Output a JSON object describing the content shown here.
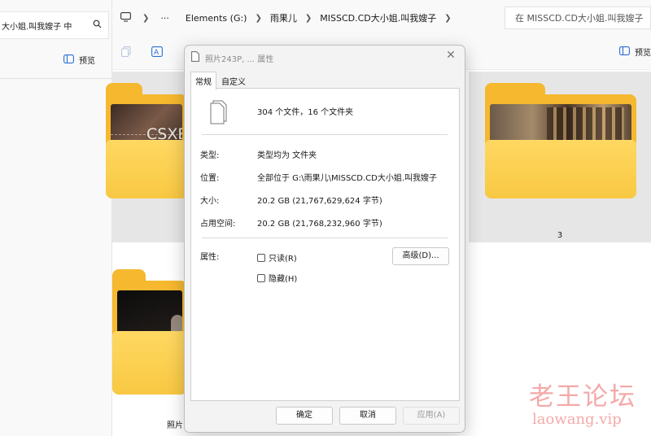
{
  "left_window": {
    "search_text": "大小姐.叫我嫂子 中",
    "preview_label": "预览"
  },
  "address_bar": {
    "crumbs": [
      "Elements (G:)",
      "雨果儿",
      "MISSCD.CD大小姐.叫我嫂子"
    ],
    "search_placeholder": "在 MISSCD.CD大小姐.叫我嫂子"
  },
  "toolbar": {
    "preview_label": "预览"
  },
  "tiles": [
    {
      "label": "",
      "photo_text": "CSXE"
    },
    {
      "label": "3"
    },
    {
      "label": "照片"
    }
  ],
  "dialog": {
    "title": "照片243P, ... 属性",
    "tabs": [
      "常规",
      "自定义"
    ],
    "summary": "304 个文件，16 个文件夹",
    "rows": [
      {
        "label": "类型:",
        "value": "类型均为 文件夹"
      },
      {
        "label": "位置:",
        "value": "全部位于 G:\\雨果儿\\MISSCD.CD大小姐.叫我嫂子"
      },
      {
        "label": "大小:",
        "value": "20.2 GB (21,767,629,624 字节)"
      },
      {
        "label": "占用空间:",
        "value": "20.2 GB (21,768,232,960 字节)"
      }
    ],
    "attributes_label": "属性:",
    "readonly_label": "只读(R)",
    "hidden_label": "隐藏(H)",
    "advanced_button": "高级(D)...",
    "ok_button": "确定",
    "cancel_button": "取消",
    "apply_button": "应用(A)"
  },
  "watermark": {
    "line1": "老王论坛",
    "line2": "laowang.vip"
  },
  "colors": {
    "folder": "#f5b82e",
    "folder_front": "#ffd862",
    "accent": "#2b6fd6",
    "watermark": "#f08d8d"
  }
}
